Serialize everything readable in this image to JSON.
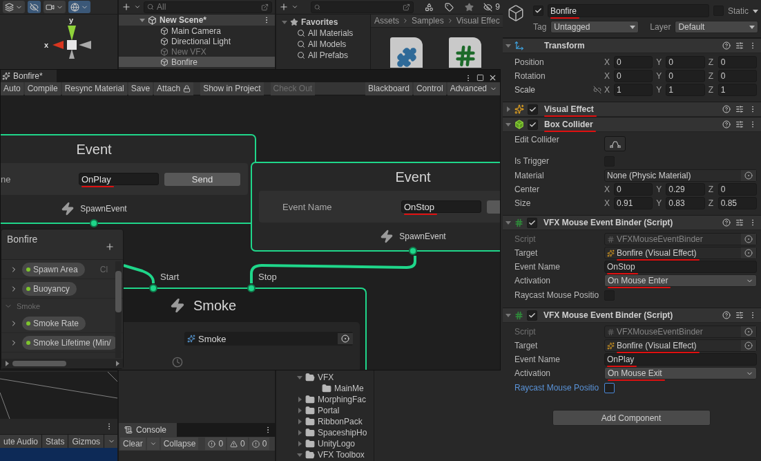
{
  "scene": {
    "toolbar": [
      {
        "kind": "layers",
        "on": false,
        "dropdown": true
      },
      {
        "kind": "visibility",
        "on": true,
        "dropdown": false
      },
      {
        "kind": "camera",
        "on": false,
        "dropdown": true
      },
      {
        "kind": "gizmo",
        "on": true,
        "dropdown": true
      }
    ],
    "gizmo_labels": {
      "y": "y",
      "x": "x"
    },
    "bottom_toolbar": [
      "ute Audio",
      "Stats",
      "Gizmos"
    ]
  },
  "hierarchy": {
    "search": {
      "placeholder": "All"
    },
    "scene": "New Scene*",
    "items": [
      {
        "label": "Main Camera",
        "dimmed": false,
        "selected": false
      },
      {
        "label": "Directional Light",
        "dimmed": false,
        "selected": false
      },
      {
        "label": "New VFX",
        "dimmed": true,
        "selected": false
      },
      {
        "label": "Bonfire",
        "dimmed": false,
        "selected": true
      }
    ]
  },
  "project": {
    "count": "9",
    "favorites": {
      "label": "Favorites",
      "expanded": true,
      "items": [
        "All Materials",
        "All Models",
        "All Prefabs"
      ]
    },
    "breadcrumb": [
      "Assets",
      "Samples",
      "Visual Effec"
    ],
    "assets": [
      {
        "kind": "puzzle"
      },
      {
        "kind": "script"
      }
    ],
    "folders": [
      {
        "label": "VFX",
        "expanded": true,
        "children": [
          {
            "label": "MainMe"
          }
        ]
      },
      {
        "label": "MorphingFac",
        "expanded": false
      },
      {
        "label": "Portal",
        "expanded": false
      },
      {
        "label": "RibbonPack",
        "expanded": false
      },
      {
        "label": "SpaceshipHo",
        "expanded": false
      },
      {
        "label": "UnityLogo",
        "expanded": false
      },
      {
        "label": "VFX Toolbox",
        "expanded": true
      }
    ]
  },
  "console": {
    "tab": "Console",
    "buttons": [
      "Clear",
      "Collapse"
    ],
    "counts": [
      {
        "kind": "info",
        "count": "0"
      },
      {
        "kind": "warning",
        "count": "0"
      },
      {
        "kind": "error",
        "count": "0"
      }
    ]
  },
  "vfx_window": {
    "title": "Bonfire*",
    "toolbar_left": [
      {
        "label": "Auto",
        "kind": "button",
        "disabled": false
      },
      {
        "label": "Compile",
        "kind": "button",
        "disabled": false
      },
      {
        "label": "Resync Material",
        "kind": "button",
        "disabled": false
      },
      {
        "label": "Save",
        "kind": "button",
        "disabled": false
      },
      {
        "label": "Attach",
        "kind": "lock",
        "disabled": false
      },
      {
        "label": "Show in Project",
        "kind": "button",
        "disabled": false
      },
      {
        "label": "Check Out",
        "kind": "button",
        "disabled": true
      }
    ],
    "toolbar_right": [
      {
        "label": "Blackboard",
        "kind": "button",
        "disabled": false
      },
      {
        "label": "Control",
        "kind": "button",
        "disabled": false
      },
      {
        "label": "Advanced",
        "kind": "dropdown",
        "disabled": false
      }
    ],
    "event_nodes": [
      {
        "title": "Event",
        "field_label": "ne",
        "value": "OnPlay",
        "underlined": true,
        "button": "Send",
        "output": "SpawnEvent"
      },
      {
        "title": "Event",
        "field_label": "Event Name",
        "value": "OnStop",
        "underlined": true,
        "output": "SpawnEvent"
      }
    ],
    "smoke_node": {
      "title": "Smoke",
      "ports": [
        "Start",
        "Stop"
      ],
      "value": "Smoke"
    },
    "blackboard": {
      "title": "Bonfire",
      "items": [
        {
          "kind": "property",
          "label": "Spawn Area",
          "expanded": false,
          "trailing": "Cl"
        },
        {
          "kind": "property",
          "label": "Buoyancy",
          "expanded": false
        },
        {
          "kind": "category",
          "label": "Smoke",
          "expanded": true,
          "children": [
            {
              "kind": "property",
              "label": "Smoke Rate",
              "expanded": false
            },
            {
              "kind": "property",
              "label": "Smoke Lifetime (Min/",
              "expanded": false
            }
          ]
        }
      ]
    }
  },
  "inspector": {
    "object": {
      "name": "Bonfire",
      "active": true,
      "underlined": true,
      "static": false,
      "static_label": "Static",
      "tag_label": "Tag",
      "tag": "Untagged",
      "layer_label": "Layer",
      "layer": "Default"
    },
    "components": [
      {
        "kind": "transform",
        "title": "Transform",
        "expanded": true,
        "rows": [
          {
            "kind": "vector",
            "label": "Position",
            "values": [
              {
                "axis": "X",
                "value": "0"
              },
              {
                "axis": "Y",
                "value": "0"
              },
              {
                "axis": "Z",
                "value": "0"
              }
            ]
          },
          {
            "kind": "vector",
            "label": "Rotation",
            "values": [
              {
                "axis": "X",
                "value": "0"
              },
              {
                "axis": "Y",
                "value": "0"
              },
              {
                "axis": "Z",
                "value": "0"
              }
            ]
          },
          {
            "kind": "vector",
            "label": "Scale",
            "linked": false,
            "values": [
              {
                "axis": "X",
                "value": "1"
              },
              {
                "axis": "Y",
                "value": "1"
              },
              {
                "axis": "Z",
                "value": "1"
              }
            ]
          }
        ]
      },
      {
        "kind": "visual_effect",
        "title": "Visual Effect",
        "enabled": true,
        "expanded": false,
        "underlined": true
      },
      {
        "kind": "box_collider",
        "title": "Box Collider",
        "enabled": true,
        "expanded": true,
        "underlined": true,
        "rows": [
          {
            "kind": "edit",
            "label": "Edit Collider"
          },
          {
            "kind": "checkbox",
            "label": "Is Trigger",
            "checked": false,
            "focused": false
          },
          {
            "kind": "object",
            "label": "Material",
            "value": "None (Physic Material)",
            "disabled": false
          },
          {
            "kind": "vector",
            "label": "Center",
            "values": [
              {
                "axis": "X",
                "value": "0"
              },
              {
                "axis": "Y",
                "value": "0.29"
              },
              {
                "axis": "Z",
                "value": "0"
              }
            ]
          },
          {
            "kind": "vector",
            "label": "Size",
            "values": [
              {
                "axis": "X",
                "value": "0.91"
              },
              {
                "axis": "Y",
                "value": "0.83"
              },
              {
                "axis": "Z",
                "value": "0.85"
              }
            ]
          }
        ]
      },
      {
        "kind": "script",
        "title": "VFX Mouse Event Binder (Script)",
        "enabled": true,
        "expanded": true,
        "rows": [
          {
            "kind": "script_ref",
            "label": "Script",
            "value": "VFXMouseEventBinder",
            "disabled": true
          },
          {
            "kind": "target",
            "label": "Target",
            "value": "Bonfire (Visual Effect)",
            "disabled": false,
            "underlined": true
          },
          {
            "kind": "text",
            "label": "Event Name",
            "value": "OnStop",
            "underlined": true
          },
          {
            "kind": "dropdown",
            "label": "Activation",
            "value": "On Mouse Enter",
            "underlined": true
          },
          {
            "kind": "checkbox",
            "label": "Raycast Mouse Positio",
            "checked": false,
            "focused": false
          }
        ]
      },
      {
        "kind": "script",
        "title": "VFX Mouse Event Binder (Script)",
        "enabled": true,
        "expanded": true,
        "rows": [
          {
            "kind": "script_ref",
            "label": "Script",
            "value": "VFXMouseEventBinder",
            "disabled": true
          },
          {
            "kind": "target",
            "label": "Target",
            "value": "Bonfire (Visual Effect)",
            "disabled": false,
            "underlined": true
          },
          {
            "kind": "text",
            "label": "Event Name",
            "value": "OnPlay",
            "underlined": true
          },
          {
            "kind": "dropdown",
            "label": "Activation",
            "value": "On Mouse Exit",
            "underlined": true
          },
          {
            "kind": "checkbox",
            "label": "Raycast Mouse Positio",
            "checked": false,
            "focused": true
          }
        ]
      }
    ],
    "add_component": "Add Component"
  }
}
